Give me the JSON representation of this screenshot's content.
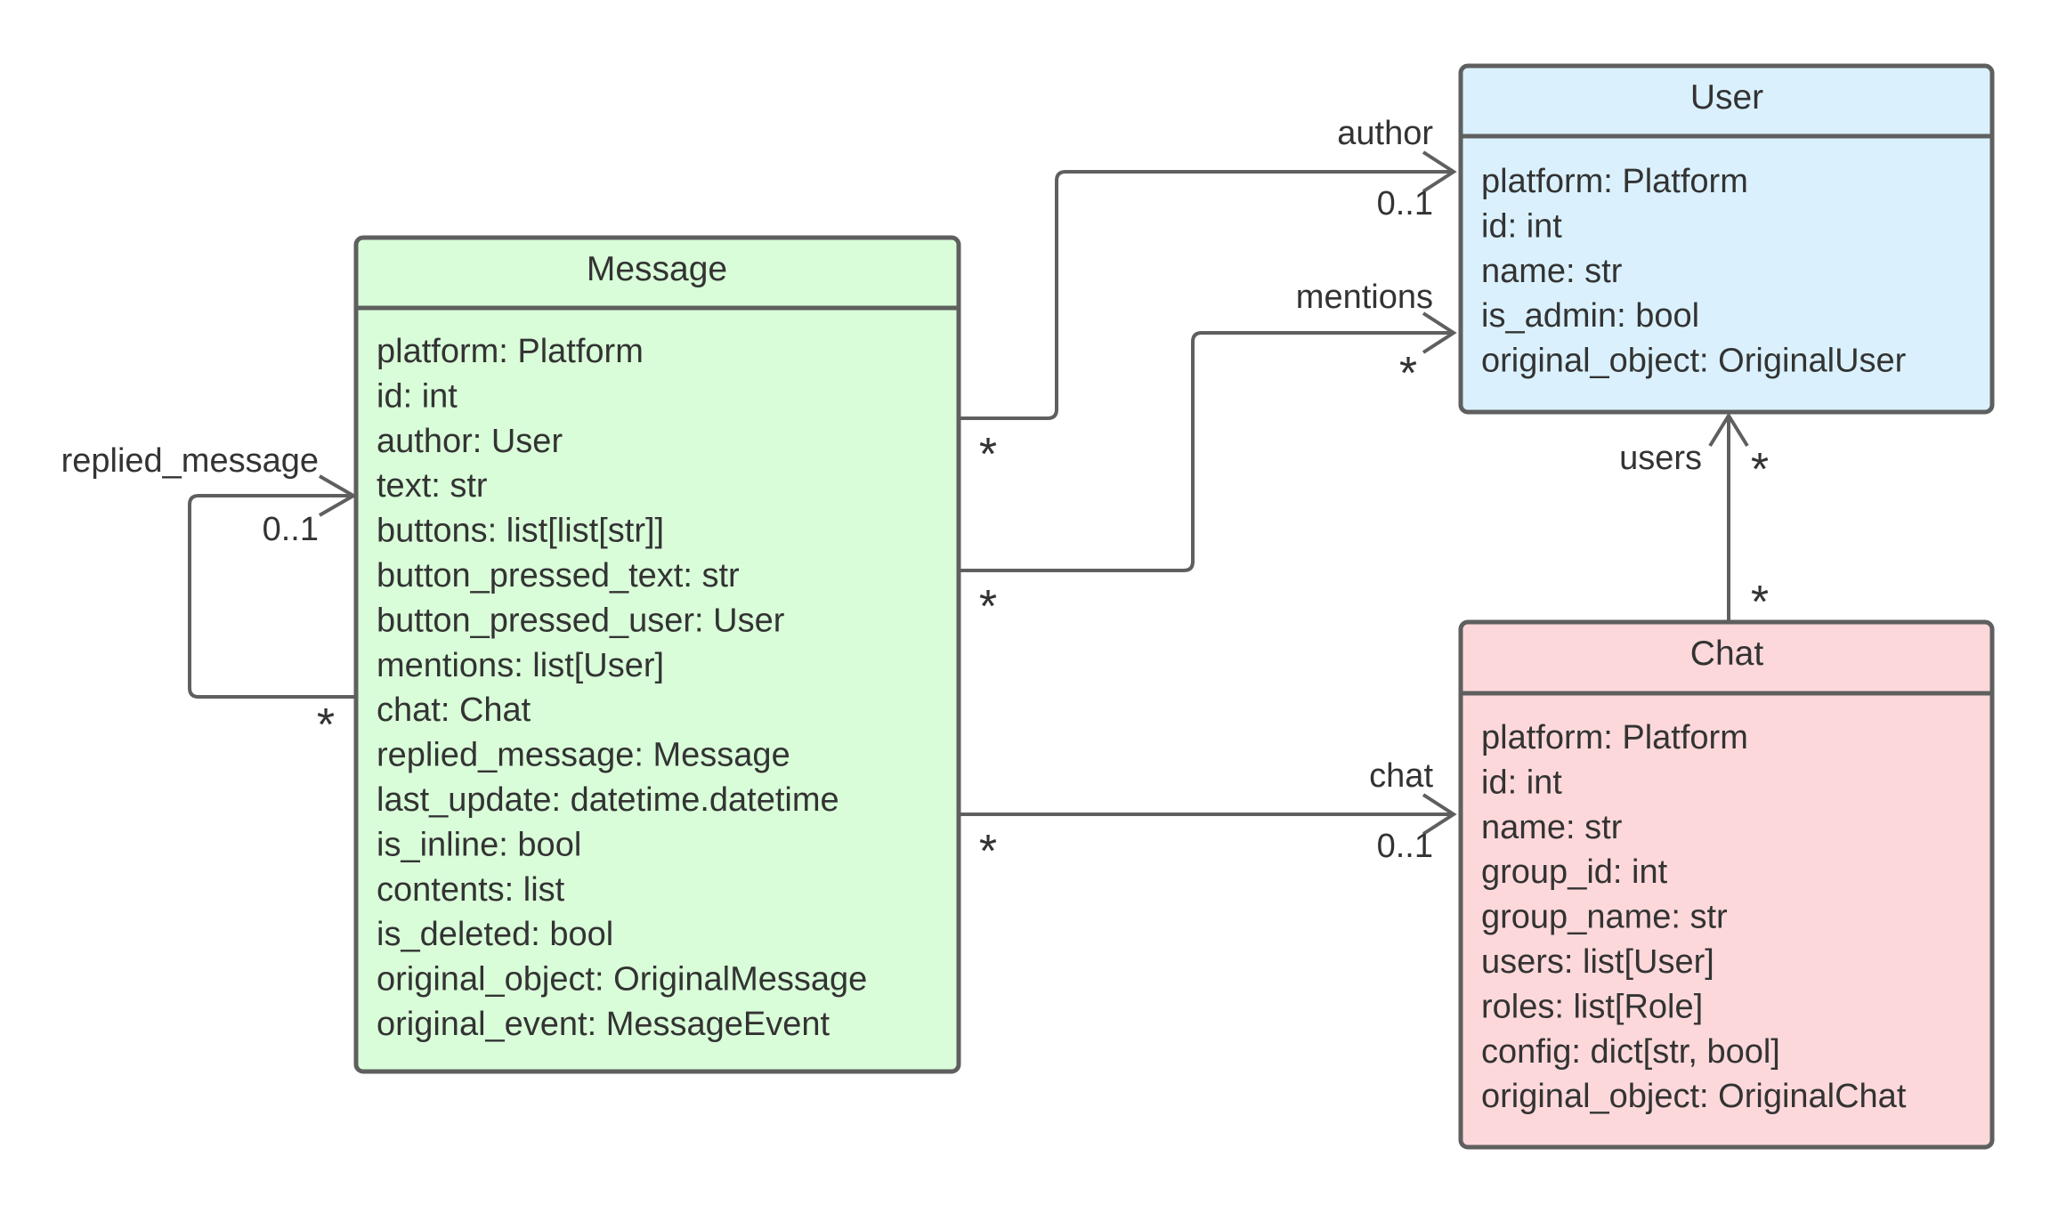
{
  "diagram": {
    "type": "uml-class-diagram",
    "colors": {
      "stroke": "#5f5f5f",
      "text": "#333333",
      "message_fill": "#d9fdd9",
      "user_fill": "#daf1fd",
      "chat_fill": "#fdd8da"
    },
    "classes": {
      "message": {
        "name": "Message",
        "attributes": [
          "platform: Platform",
          "id: int",
          "author: User",
          "text: str",
          "buttons: list[list[str]]",
          "button_pressed_text: str",
          "button_pressed_user: User",
          "mentions: list[User]",
          "chat: Chat",
          "replied_message: Message",
          "last_update: datetime.datetime",
          "is_inline: bool",
          "contents: list",
          "is_deleted: bool",
          "original_object: OriginalMessage",
          "original_event: MessageEvent"
        ]
      },
      "user": {
        "name": "User",
        "attributes": [
          "platform: Platform",
          "id: int",
          "name: str",
          "is_admin: bool",
          "original_object: OriginalUser"
        ]
      },
      "chat": {
        "name": "Chat",
        "attributes": [
          "platform: Platform",
          "id: int",
          "name: str",
          "group_id: int",
          "group_name: str",
          "users: list[User]",
          "roles: list[Role]",
          "config: dict[str, bool]",
          "original_object: OriginalChat"
        ]
      }
    },
    "associations": {
      "replied_message": {
        "from": "Message",
        "to": "Message",
        "label": "replied_message",
        "source_multiplicity": "*",
        "target_multiplicity": "0..1"
      },
      "author": {
        "from": "Message",
        "to": "User",
        "label": "author",
        "source_multiplicity": "*",
        "target_multiplicity": "0..1"
      },
      "mentions": {
        "from": "Message",
        "to": "User",
        "label": "mentions",
        "source_multiplicity": "*",
        "target_multiplicity": "*"
      },
      "chat": {
        "from": "Message",
        "to": "Chat",
        "label": "chat",
        "source_multiplicity": "*",
        "target_multiplicity": "0..1"
      },
      "users": {
        "from": "Chat",
        "to": "User",
        "label": "users",
        "source_multiplicity": "*",
        "target_multiplicity": "*"
      }
    }
  }
}
